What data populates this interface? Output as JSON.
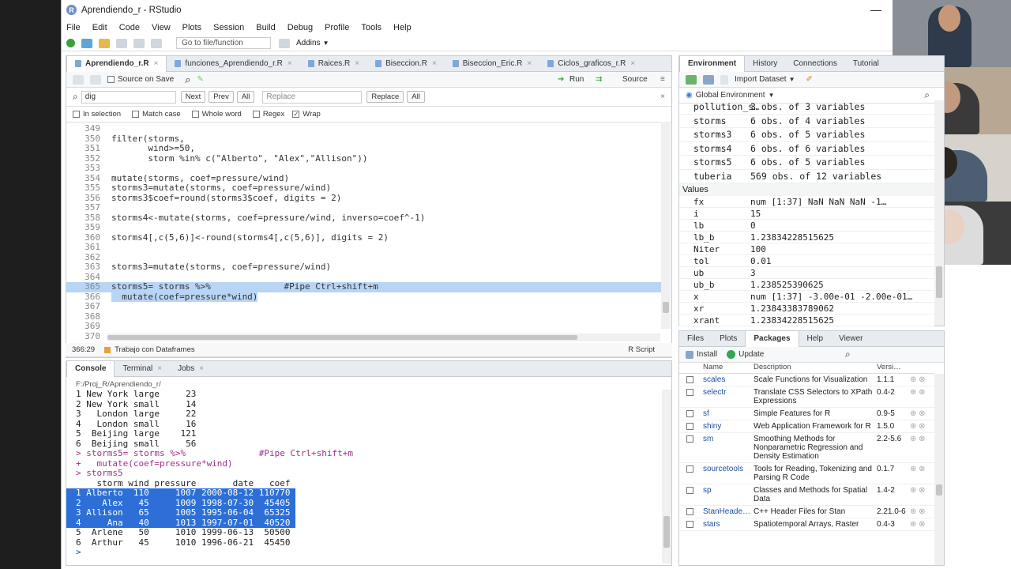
{
  "window": {
    "title": "Aprendiendo_r - RStudio"
  },
  "menu": [
    "File",
    "Edit",
    "Code",
    "View",
    "Plots",
    "Session",
    "Build",
    "Debug",
    "Profile",
    "Tools",
    "Help"
  ],
  "toolbar": {
    "goto_placeholder": "Go to file/function",
    "addins": "Addins"
  },
  "editor": {
    "tabs": [
      "Aprendiendo_r.R",
      "funciones_Aprendiendo_r.R",
      "Raices.R",
      "Biseccion.R",
      "Biseccion_Eric.R",
      "Ciclos_graficos_r.R"
    ],
    "source_on_save": "Source on Save",
    "run": "Run",
    "source": "Source",
    "find": {
      "value": "dig",
      "next": "Next",
      "prev": "Prev",
      "all": "All",
      "replace_placeholder": "Replace",
      "replace": "Replace",
      "replace_all": "All"
    },
    "options": {
      "in_selection": "In selection",
      "match_case": "Match case",
      "whole_word": "Whole word",
      "regex": "Regex",
      "wrap": "Wrap"
    },
    "lines": [
      {
        "n": "349",
        "t": ""
      },
      {
        "n": "350",
        "t": "filter(storms,"
      },
      {
        "n": "351",
        "t": "       wind>=50,"
      },
      {
        "n": "352",
        "t": "       storm %in% c(\"Alberto\", \"Alex\",\"Allison\"))"
      },
      {
        "n": "353",
        "t": ""
      },
      {
        "n": "354",
        "t": "mutate(storms, coef=pressure/wind)"
      },
      {
        "n": "355",
        "t": "storms3=mutate(storms, coef=pressure/wind)"
      },
      {
        "n": "356",
        "t": "storms3$coef=round(storms3$coef, digits = 2)"
      },
      {
        "n": "357",
        "t": ""
      },
      {
        "n": "358",
        "t": "storms4<-mutate(storms, coef=pressure/wind, inverso=coef^-1)"
      },
      {
        "n": "359",
        "t": ""
      },
      {
        "n": "360",
        "t": "storms4[,c(5,6)]<-round(storms4[,c(5,6)], digits = 2)"
      },
      {
        "n": "361",
        "t": ""
      },
      {
        "n": "362",
        "t": ""
      },
      {
        "n": "363",
        "t": "storms3=mutate(storms, coef=pressure/wind)"
      },
      {
        "n": "364",
        "t": ""
      },
      {
        "n": "365",
        "t": "storms5= storms %>%              #Pipe Ctrl+shift+m"
      },
      {
        "n": "366",
        "t": "  mutate(coef=pressure*wind)"
      },
      {
        "n": "367",
        "t": ""
      },
      {
        "n": "368",
        "t": ""
      },
      {
        "n": "369",
        "t": ""
      },
      {
        "n": "370",
        "t": ""
      }
    ],
    "status_pos": "366:29",
    "status_section": "Trabajo con Dataframes",
    "status_lang": "R Script"
  },
  "console": {
    "tabs": [
      "Console",
      "Terminal",
      "Jobs"
    ],
    "path": "F:/Proj_R/Aprendiendo_r/",
    "lines": [
      "1 New York large     23",
      "2 New York small     14",
      "3   London large     22",
      "4   London small     16",
      "5  Beijing large    121",
      "6  Beijing small     56",
      "> storms5= storms %>%              #Pipe Ctrl+shift+m",
      "+   mutate(coef=pressure*wind)",
      "> storms5",
      "    storm wind pressure       date   coef",
      "1 Alberto  110     1007 2000-08-12 110770",
      "2    Alex   45     1009 1998-07-30  45405",
      "3 Allison   65     1005 1995-06-04  65325",
      "4     Ana   40     1013 1997-07-01  40520",
      "5  Arlene   50     1010 1999-06-13  50500",
      "6  Arthur   45     1010 1996-06-21  45450",
      ">"
    ]
  },
  "environment": {
    "tabs": [
      "Environment",
      "History",
      "Connections",
      "Tutorial"
    ],
    "import_dataset": "Import Dataset",
    "scope": "Global Environment",
    "data": [
      {
        "name": "pollution_s…",
        "value": "3 obs. of 3 variables"
      },
      {
        "name": "storms",
        "value": "6 obs. of 4 variables"
      },
      {
        "name": "storms3",
        "value": "6 obs. of 5 variables"
      },
      {
        "name": "storms4",
        "value": "6 obs. of 6 variables"
      },
      {
        "name": "storms5",
        "value": "6 obs. of 5 variables"
      },
      {
        "name": "tuberia",
        "value": "569 obs. of 12 variables"
      }
    ],
    "values_header": "Values",
    "values": [
      {
        "name": "fx",
        "value": "num [1:37] NaN NaN NaN -1…"
      },
      {
        "name": "i",
        "value": "15"
      },
      {
        "name": "lb",
        "value": "0"
      },
      {
        "name": "lb_b",
        "value": "1.23834228515625"
      },
      {
        "name": "Niter",
        "value": "100"
      },
      {
        "name": "tol",
        "value": "0.01"
      },
      {
        "name": "ub",
        "value": "3"
      },
      {
        "name": "ub_b",
        "value": "1.238525390625"
      },
      {
        "name": "x",
        "value": "num [1:37] -3.00e-01 -2.00e-01…"
      },
      {
        "name": "xr",
        "value": "1.23843383789062"
      },
      {
        "name": "xrant",
        "value": "1.23834228515625"
      }
    ]
  },
  "packages": {
    "tabs": [
      "Files",
      "Plots",
      "Packages",
      "Help",
      "Viewer"
    ],
    "install": "Install",
    "update": "Update",
    "headers": [
      "Name",
      "Description",
      "Versi…"
    ],
    "rows": [
      {
        "name": "scales",
        "desc": "Scale Functions for Visualization",
        "ver": "1.1.1"
      },
      {
        "name": "selectr",
        "desc": "Translate CSS Selectors to XPath Expressions",
        "ver": "0.4-2"
      },
      {
        "name": "sf",
        "desc": "Simple Features for R",
        "ver": "0.9-5"
      },
      {
        "name": "shiny",
        "desc": "Web Application Framework for R",
        "ver": "1.5.0"
      },
      {
        "name": "sm",
        "desc": "Smoothing Methods for Nonparametric Regression and Density Estimation",
        "ver": "2.2-5.6"
      },
      {
        "name": "sourcetools",
        "desc": "Tools for Reading, Tokenizing and Parsing R Code",
        "ver": "0.1.7"
      },
      {
        "name": "sp",
        "desc": "Classes and Methods for Spatial Data",
        "ver": "1.4-2"
      },
      {
        "name": "StanHeade…",
        "desc": "C++ Header Files for Stan",
        "ver": "2.21.0-6"
      },
      {
        "name": "stars",
        "desc": "Spatiotemporal Arrays, Raster",
        "ver": "0.4-3"
      }
    ]
  }
}
